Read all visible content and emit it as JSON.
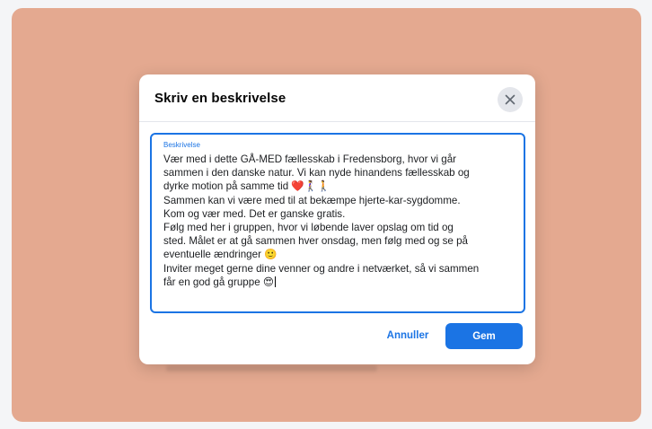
{
  "dialog": {
    "title": "Skriv en beskrivelse",
    "close_icon": "close-icon",
    "field_label": "Beskrivelse",
    "text": "Vær med i dette GÅ-MED fællesskab i Fredensborg, hvor vi går\nsammen i den danske natur. Vi kan nyde hinandens fællesskab og\ndyrke motion på samme tid ❤️🚶‍♀️🚶\nSammen kan vi være med til at bekæmpe hjerte-kar-sygdomme.\nKom og vær med. Det er ganske gratis.\nFølg med her i gruppen, hvor vi løbende laver opslag om tid og\nsted. Målet er at gå sammen hver onsdag, men følg med og se på\neventuelle ændringer 🙂\nInviter meget gerne dine venner og andre i netværket, så vi sammen\nfår en god gå gruppe 😍",
    "cancel_label": "Annuller",
    "save_label": "Gem"
  },
  "colors": {
    "backdrop": "#e4a990",
    "accent": "#1b74e4",
    "modal_bg": "#ffffff"
  }
}
